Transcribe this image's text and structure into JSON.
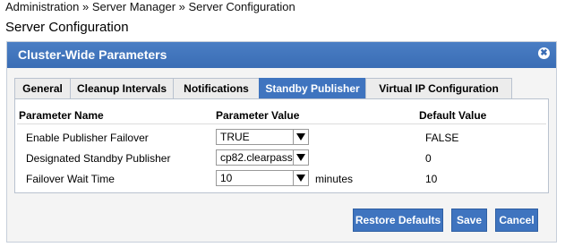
{
  "breadcrumb": "Administration » Server Manager » Server Configuration",
  "page_title": "Server Configuration",
  "dialog": {
    "title": "Cluster-Wide Parameters",
    "close_glyph": "✖"
  },
  "tabs": [
    {
      "label": "General"
    },
    {
      "label": "Cleanup Intervals"
    },
    {
      "label": "Notifications"
    },
    {
      "label": "Standby Publisher",
      "active": true
    },
    {
      "label": "Virtual IP  Configuration"
    }
  ],
  "table": {
    "headers": {
      "name": "Parameter Name",
      "value": "Parameter Value",
      "default": "Default Value"
    },
    "rows": [
      {
        "label": "Enable Publisher Failover",
        "value": "TRUE",
        "default": "FALSE"
      },
      {
        "label": "Designated Standby Publisher",
        "value": "cp82.clearpass",
        "default": "0"
      },
      {
        "label": "Failover Wait Time",
        "value": "10",
        "unit": "minutes",
        "default": "10"
      }
    ]
  },
  "buttons": {
    "restore": "Restore Defaults",
    "save": "Save",
    "cancel": "Cancel"
  },
  "colors": {
    "accent": "#3f74bf",
    "header_blue": "#3a6db5"
  }
}
